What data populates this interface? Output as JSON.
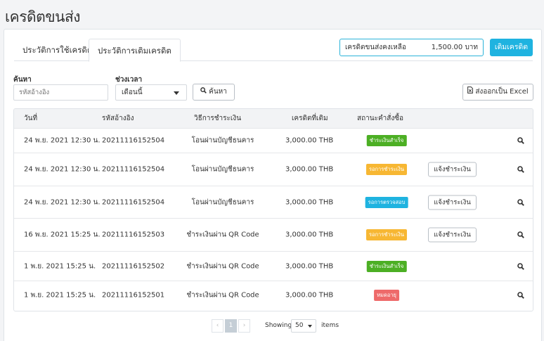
{
  "page": {
    "title": "เครดิตขนส่ง"
  },
  "tabs": [
    {
      "label": "ประวัติการใช้เครดิต"
    },
    {
      "label": "ประวัติการเติมเครดิต"
    }
  ],
  "balance": {
    "label": "เครดิตขนส่งคงเหลือ",
    "value": "1,500.00 บาท"
  },
  "topup_button": "เติมเครดิต",
  "filters": {
    "search_label": "ค้นหา",
    "search_placeholder": "รหัสอ้างอิง",
    "period_label": "ช่วงเวลา",
    "period_value": "เดือนนี้",
    "search_button": "ค้นหา",
    "export_button": "ส่งออกเป็น Excel"
  },
  "table": {
    "columns": [
      "วันที่",
      "รหัสอ้างอิง",
      "วิธีการชำระเงิน",
      "เครดิตที่เติม",
      "สถานะคำสั่งซื้อ"
    ],
    "notify_label": "แจ้งชำระเงิน",
    "rows": [
      {
        "date": "24 พ.ย. 2021 12:30 น.",
        "ref": "20211116152504",
        "method": "โอนผ่านบัญชีธนคาร",
        "amount": "3,000.00 THB",
        "status": "ชำระเงินสำเร็จ",
        "status_color": "#4caf24",
        "notify": false
      },
      {
        "date": "24 พ.ย. 2021 12:30 น.",
        "ref": "20211116152504",
        "method": "โอนผ่านบัญชีธนคาร",
        "amount": "3,000.00 THB",
        "status": "รอการชำระเงิน",
        "status_color": "#f7b733",
        "notify": true
      },
      {
        "date": "24 พ.ย. 2021 12:30 น.",
        "ref": "20211116152504",
        "method": "โอนผ่านบัญชีธนคาร",
        "amount": "3,000.00 THB",
        "status": "รอการตรวจสอบ",
        "status_color": "#1fb3e0",
        "notify": true
      },
      {
        "date": "16 พ.ย. 2021 15:25 น.",
        "ref": "20211116152503",
        "method": "ชำระเงินผ่าน QR Code",
        "amount": "3,000.00 THB",
        "status": "รอการชำระเงิน",
        "status_color": "#f7b733",
        "notify": true
      },
      {
        "date": "1 พ.ย. 2021 15:25 น.",
        "ref": "20211116152502",
        "method": "ชำระเงินผ่าน QR Code",
        "amount": "3,000.00 THB",
        "status": "ชำระเงินสำเร็จ",
        "status_color": "#4caf24",
        "notify": false
      },
      {
        "date": "1 พ.ย. 2021 15:25 น.",
        "ref": "20211116152501",
        "method": "ชำระเงินผ่าน QR Code",
        "amount": "3,000.00 THB",
        "status": "หมดอายุ",
        "status_color": "#ee6a6a",
        "notify": false
      }
    ]
  },
  "pagination": {
    "prev": "‹",
    "current": "1",
    "next": "›",
    "showing_label": "Showing",
    "per_page": "50",
    "items_label": "items"
  },
  "icons": {
    "search": "search-icon",
    "export": "excel-file-icon",
    "row_action": "magnifier-icon"
  }
}
